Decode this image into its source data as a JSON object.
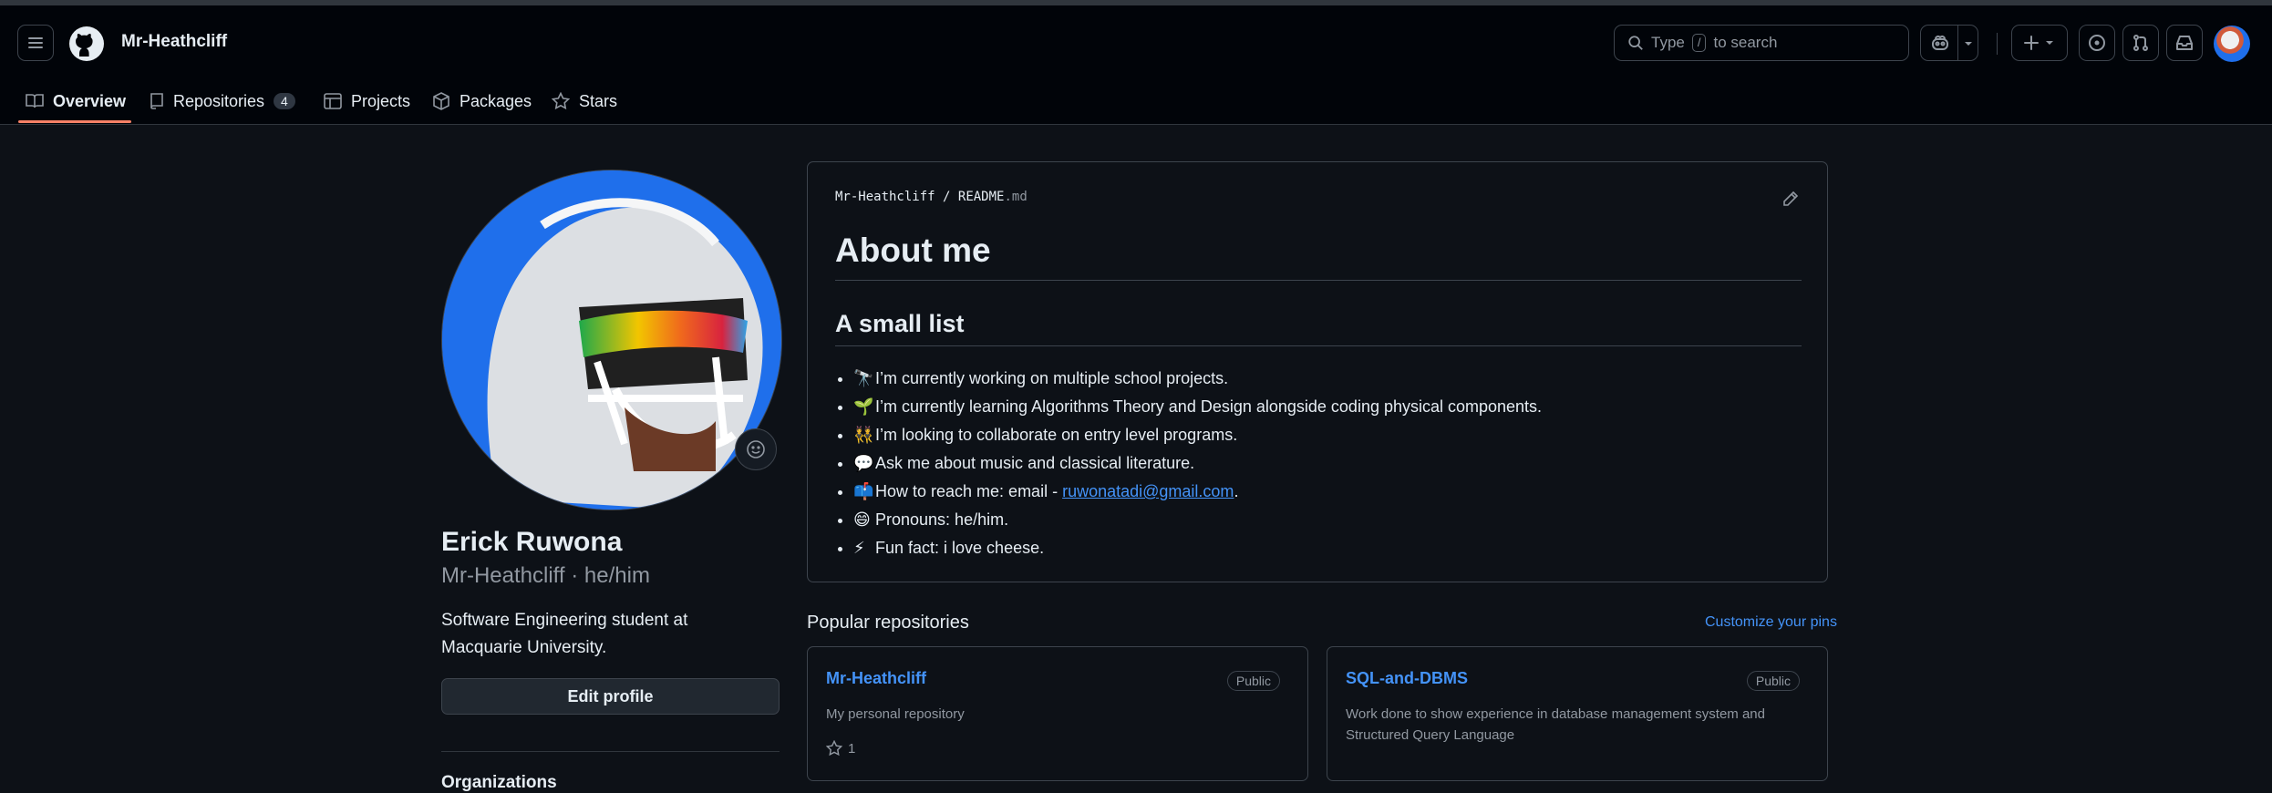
{
  "header": {
    "username": "Mr-Heathcliff",
    "search": {
      "prefix": "Type",
      "key": "/",
      "suffix": "to search"
    }
  },
  "tabs": [
    {
      "label": "Overview",
      "icon": "book-icon"
    },
    {
      "label": "Repositories",
      "icon": "repo-icon",
      "count": "4"
    },
    {
      "label": "Projects",
      "icon": "table-icon"
    },
    {
      "label": "Packages",
      "icon": "package-icon"
    },
    {
      "label": "Stars",
      "icon": "star-icon"
    }
  ],
  "profile": {
    "name": "Erick Ruwona",
    "handle": "Mr-Heathcliff · he/him",
    "bio": "Software Engineering student at Macquarie University.",
    "edit_label": "Edit profile",
    "organizations_label": "Organizations"
  },
  "readme": {
    "path_user": "Mr-Heathcliff",
    "path_sep": "/",
    "path_file": "README",
    "path_ext": ".md",
    "h1": "About me",
    "h2": "A small list",
    "items": [
      {
        "emoji": "🔭",
        "text": "I’m currently working on multiple school projects."
      },
      {
        "emoji": "🌱",
        "text": "I’m currently learning Algorithms Theory and Design alongside coding physical components."
      },
      {
        "emoji": "👯",
        "text": "I’m looking to collaborate on entry level programs."
      },
      {
        "emoji": "💬",
        "text": "Ask me about music and classical literature."
      },
      {
        "emoji": "📫",
        "text": "How to reach me: email - ",
        "link": "ruwonatadi@gmail.com",
        "after": "."
      },
      {
        "emoji": "😄",
        "text": "Pronouns: he/him."
      },
      {
        "emoji": "⚡",
        "text": "Fun fact: i love cheese."
      }
    ]
  },
  "popular": {
    "title": "Popular repositories",
    "customize": "Customize your pins",
    "repos": [
      {
        "name": "Mr-Heathcliff",
        "visibility": "Public",
        "description": "My personal repository",
        "stars": "1"
      },
      {
        "name": "SQL-and-DBMS",
        "visibility": "Public",
        "description": "Work done to show experience in database management system and Structured Query Language"
      }
    ]
  },
  "colors": {
    "accent": "#4493f8",
    "tab_underline": "#f78166",
    "background": "#0d1117"
  }
}
